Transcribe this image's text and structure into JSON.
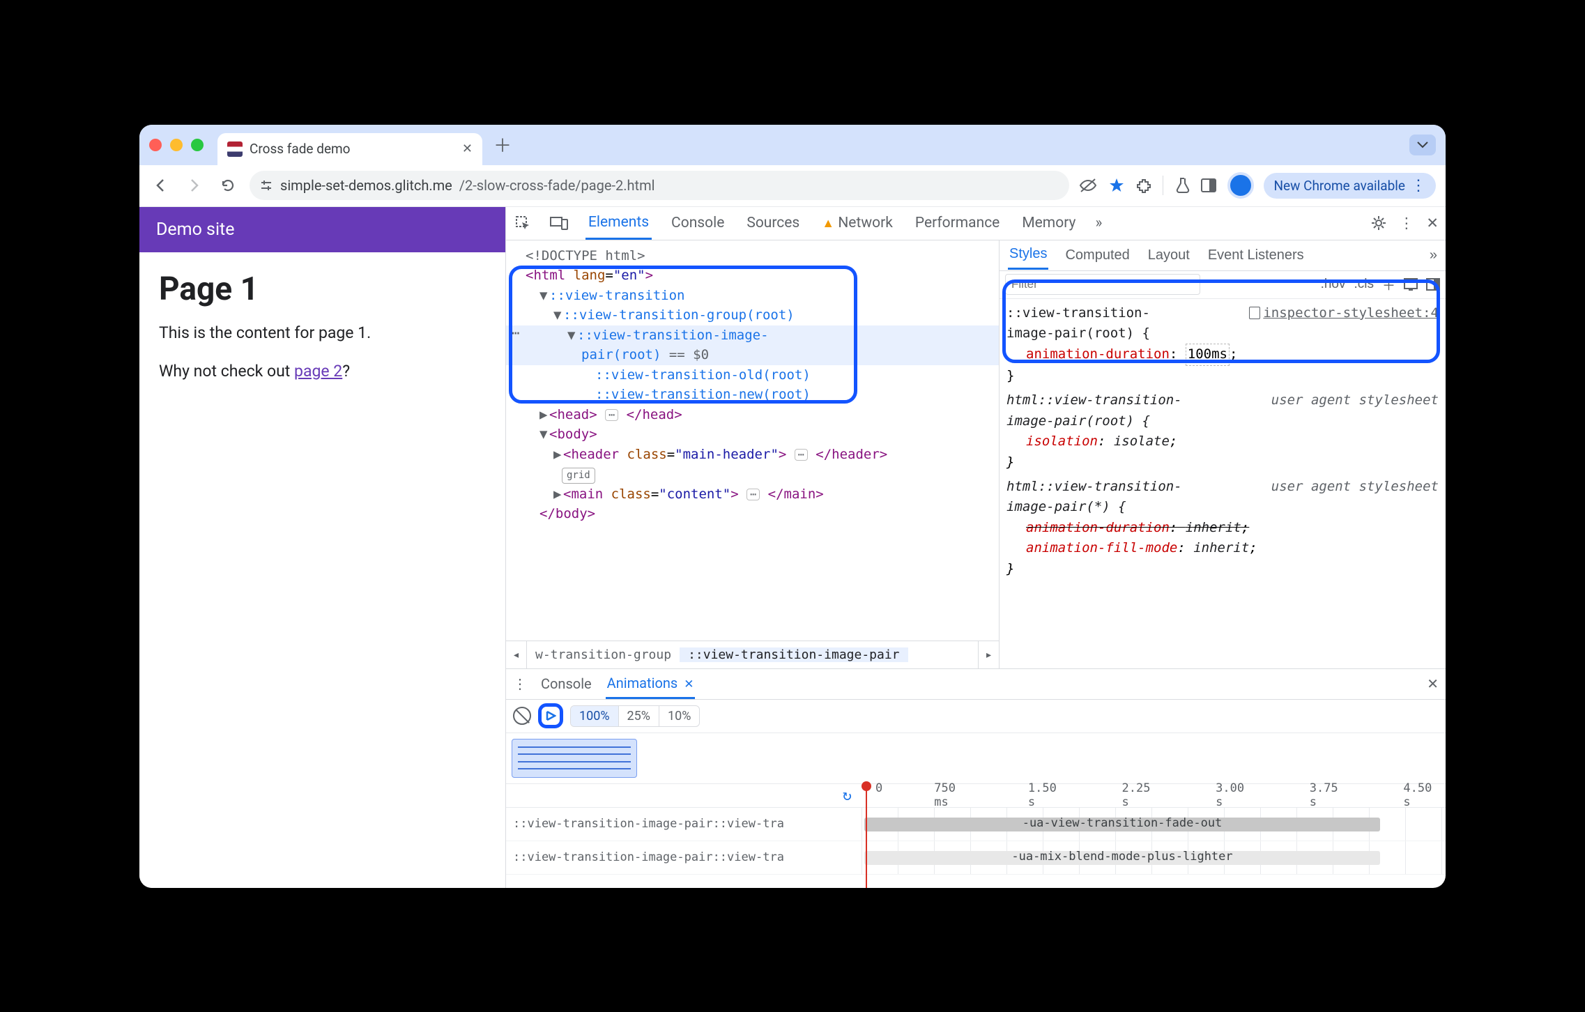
{
  "window": {
    "tab_title": "Cross fade demo"
  },
  "omnibox": {
    "url_host": "simple-set-demos.glitch.me",
    "url_path": "/2-slow-cross-fade/page-2.html",
    "update_label": "New Chrome available"
  },
  "page": {
    "site_title": "Demo site",
    "h1": "Page 1",
    "p1": "This is the content for page 1.",
    "p2_prefix": "Why not check out ",
    "p2_link": "page 2",
    "p2_suffix": "?"
  },
  "devtools_tabs": {
    "elements": "Elements",
    "console": "Console",
    "sources": "Sources",
    "network": "Network",
    "performance": "Performance",
    "memory": "Memory"
  },
  "dom_tree": {
    "doctype": "<!DOCTYPE html>",
    "html_open": "<html lang=\"en\">",
    "vt": "::view-transition",
    "vt_group": "::view-transition-group(root)",
    "vt_ipair_a": "::view-transition-image-",
    "vt_ipair_b": "pair(root)",
    "eq0": " == $0",
    "vt_old": "::view-transition-old(root)",
    "vt_new": "::view-transition-new(root)",
    "head_open": "<head>",
    "head_close": "</head>",
    "body_open": "<body>",
    "header_open": "<header class=\"main-header\">",
    "header_close": "</header>",
    "grid_badge": "grid",
    "main_open": "<main class=\"content\">",
    "main_close": "</main>",
    "body_close": "</body>"
  },
  "crumbs": {
    "c1": "w-transition-group",
    "c2": "::view-transition-image-pair"
  },
  "styles_tabs": {
    "styles": "Styles",
    "computed": "Computed",
    "layout": "Layout",
    "listeners": "Event Listeners"
  },
  "styles_filter": {
    "placeholder": "Filter",
    "hov": ":hov",
    "cls": ".cls"
  },
  "rules": {
    "r1_sel": "::view-transition-image-pair(root) {",
    "r1_src": "inspector-stylesheet:4",
    "r1_prop": "animation-duration",
    "r1_val": "100ms",
    "r2_sel": "html::view-transition-image-pair(root) {",
    "r2_src": "user agent stylesheet",
    "r2_prop": "isolation",
    "r2_val": "isolate",
    "r3_sel": "html::view-transition-image-pair(*) {",
    "r3_src": "user agent stylesheet",
    "r3_p1": "animation-duration",
    "r3_v1": "inherit",
    "r3_p2": "animation-fill-mode",
    "r3_v2": "inherit",
    "close_brace": "}"
  },
  "drawer": {
    "console": "Console",
    "animations": "Animations"
  },
  "anim": {
    "speed100": "100%",
    "speed25": "25%",
    "speed10": "10%",
    "ticks": [
      "0",
      "750 ms",
      "1.50 s",
      "2.25 s",
      "3.00 s",
      "3.75 s",
      "4.50 s"
    ],
    "row1_name": "::view-transition-image-pair::view-tra",
    "row1_bar": "-ua-view-transition-fade-out",
    "row2_name": "::view-transition-image-pair::view-tra",
    "row2_bar": "-ua-mix-blend-mode-plus-lighter"
  }
}
